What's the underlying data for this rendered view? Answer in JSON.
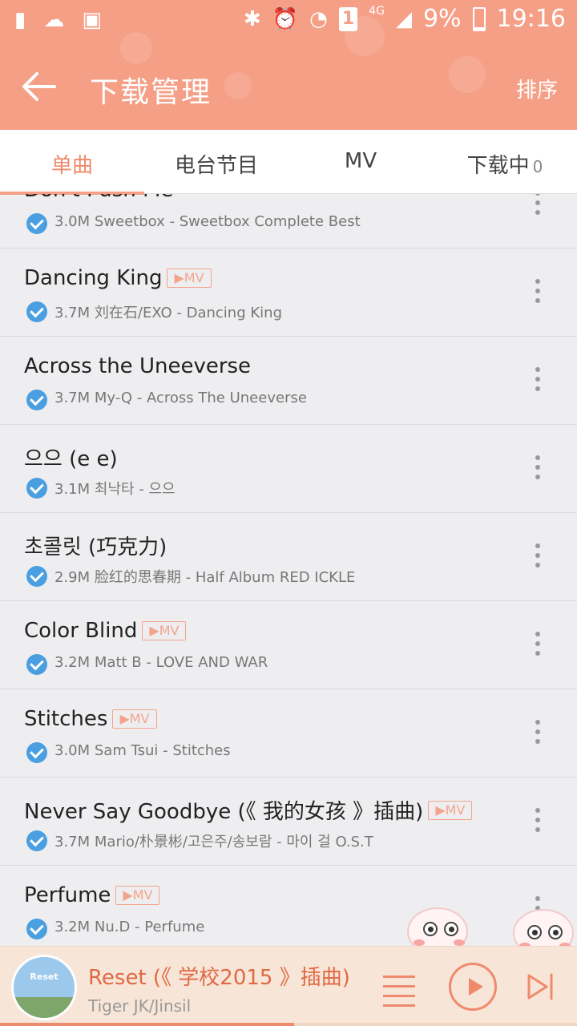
{
  "colors": {
    "accent": "#f59f86",
    "accent_text": "#f08a6c",
    "check": "#4a9fe0",
    "background": "#eeeef0"
  },
  "status_bar": {
    "sim_label": "1",
    "network": "4G",
    "battery": "9%",
    "time": "19:16"
  },
  "header": {
    "title": "下载管理",
    "sort_label": "排序"
  },
  "tabs": [
    {
      "label": "单曲",
      "active": true
    },
    {
      "label": "电台节目",
      "active": false
    },
    {
      "label": "MV",
      "active": false
    },
    {
      "label": "下载中",
      "count": "0",
      "active": false
    }
  ],
  "mv_badge": "▶MV",
  "songs": [
    {
      "title": "Don't Push Me",
      "mv": false,
      "sub": "3.0M Sweetbox - Sweetbox Complete Best"
    },
    {
      "title": "Dancing King",
      "mv": true,
      "sub": "3.7M 刘在石/EXO - Dancing King"
    },
    {
      "title": "Across the Uneeverse",
      "mv": false,
      "sub": "3.7M My-Q - Across The Uneeverse"
    },
    {
      "title": "으으 (e e)",
      "mv": false,
      "sub": "3.1M 최낙타 - 으으"
    },
    {
      "title": "초콜릿 (巧克力)",
      "mv": false,
      "sub": "2.9M 脸红的思春期 - Half Album RED ICKLE"
    },
    {
      "title": "Color Blind",
      "mv": true,
      "sub": "3.2M Matt B - LOVE AND WAR"
    },
    {
      "title": "Stitches",
      "mv": true,
      "sub": "3.0M Sam Tsui - Stitches"
    },
    {
      "title": "Never Say Goodbye (《 我的女孩 》插曲)",
      "mv": true,
      "sub": "3.7M Mario/朴景彬/고은주/송보람 - 마이 걸 O.S.T"
    },
    {
      "title": "Perfume",
      "mv": true,
      "sub": "3.2M Nu.D - Perfume"
    }
  ],
  "player": {
    "title": "Reset (《 学校2015 》插曲)",
    "artist": "Tiger JK/Jinsil",
    "cover_text": "Reset",
    "progress": 0.51
  }
}
